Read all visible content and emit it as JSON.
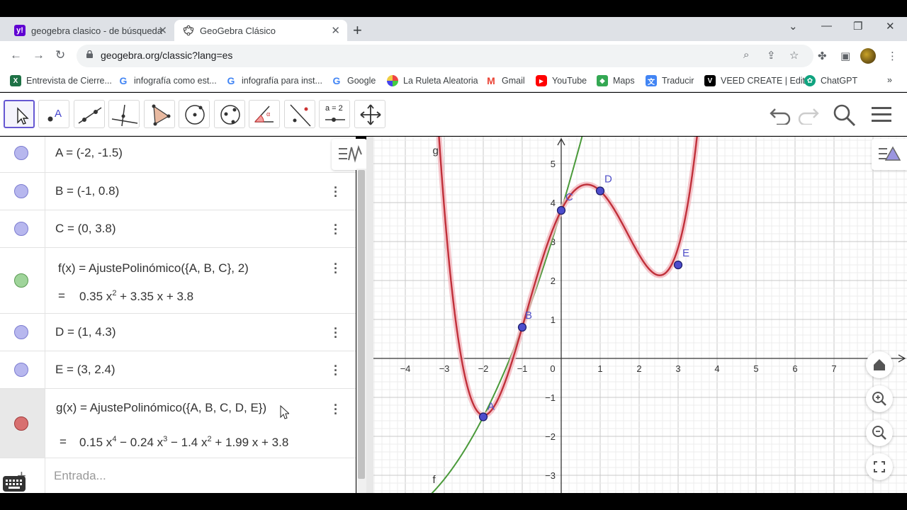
{
  "browser": {
    "tabs": [
      {
        "title": "geogebra clasico - de búsqueda",
        "icon": "yahoo-icon",
        "color": "#6001d2"
      },
      {
        "title": "GeoGebra Clásico",
        "icon": "geogebra-icon",
        "active": true
      }
    ],
    "url": "geogebra.org/classic?lang=es",
    "bookmarks": [
      {
        "label": "Entrevista de Cierre...",
        "icon": "excel-icon"
      },
      {
        "label": "infografía como est...",
        "icon": "google-icon"
      },
      {
        "label": "infografía para inst...",
        "icon": "google-icon"
      },
      {
        "label": "Google",
        "icon": "google-icon"
      },
      {
        "label": "La Ruleta Aleatoria",
        "icon": "ruleta-icon"
      },
      {
        "label": "Gmail",
        "icon": "gmail-icon"
      },
      {
        "label": "YouTube",
        "icon": "youtube-icon"
      },
      {
        "label": "Maps",
        "icon": "maps-icon"
      },
      {
        "label": "Traducir",
        "icon": "translate-icon"
      },
      {
        "label": "VEED CREATE | Edit",
        "icon": "veed-icon"
      },
      {
        "label": "ChatGPT",
        "icon": "chatgpt-icon"
      }
    ]
  },
  "toolbar": {
    "tools": [
      "move",
      "point",
      "line",
      "perpendicular",
      "polygon",
      "circle",
      "conic",
      "angle",
      "reflect",
      "slider",
      "move-view"
    ],
    "slider_label": "a = 2"
  },
  "algebra": {
    "rows": [
      {
        "text": "A = (-2, -1.5)",
        "color": "#b7b7ee"
      },
      {
        "text": "B = (-1, 0.8)",
        "color": "#b7b7ee"
      },
      {
        "text": "C = (0, 3.8)",
        "color": "#b7b7ee"
      },
      {
        "text": "f(x) = AjustePolinómico({A, B, C}, 2)",
        "color": "#9fd49a"
      },
      {
        "text": "D = (1, 4.3)",
        "color": "#b7b7ee"
      },
      {
        "text": "E = (3, 2.4)",
        "color": "#b7b7ee"
      },
      {
        "text": "g(x) = AjustePolinómico({A, B, C, D, E})",
        "color": "#d87070"
      }
    ],
    "f_eq": "=",
    "f_value": {
      "a": "0.35 x",
      "a_sup": "2",
      "b": " + 3.35 x + 3.8"
    },
    "g_value": {
      "a": "0.15 x",
      "a_sup": "4",
      "b": " − 0.24 x",
      "b_sup": "3",
      "c": " − 1.4 x",
      "c_sup": "2",
      "d": " + 1.99 x + 3.8"
    },
    "input_placeholder": "Entrada...",
    "plus": "+"
  },
  "graph": {
    "x_ticks": [
      "−4",
      "−3",
      "−2",
      "−1",
      "0",
      "1",
      "2",
      "3",
      "4",
      "5",
      "6",
      "7"
    ],
    "y_ticks": [
      "5",
      "4",
      "3",
      "2",
      "1",
      "−1",
      "−2",
      "−3"
    ],
    "points": [
      {
        "name": "A",
        "x": -2,
        "y": -1.5
      },
      {
        "name": "B",
        "x": -1,
        "y": 0.8
      },
      {
        "name": "C",
        "x": 0,
        "y": 3.8
      },
      {
        "name": "D",
        "x": 1,
        "y": 4.3
      },
      {
        "name": "E",
        "x": 3,
        "y": 2.4
      }
    ],
    "curve_labels": {
      "f": "f",
      "g": "g"
    },
    "colors": {
      "f": "#4a9a3a",
      "g": "#c0303a",
      "point": "#4d4dcc"
    }
  }
}
